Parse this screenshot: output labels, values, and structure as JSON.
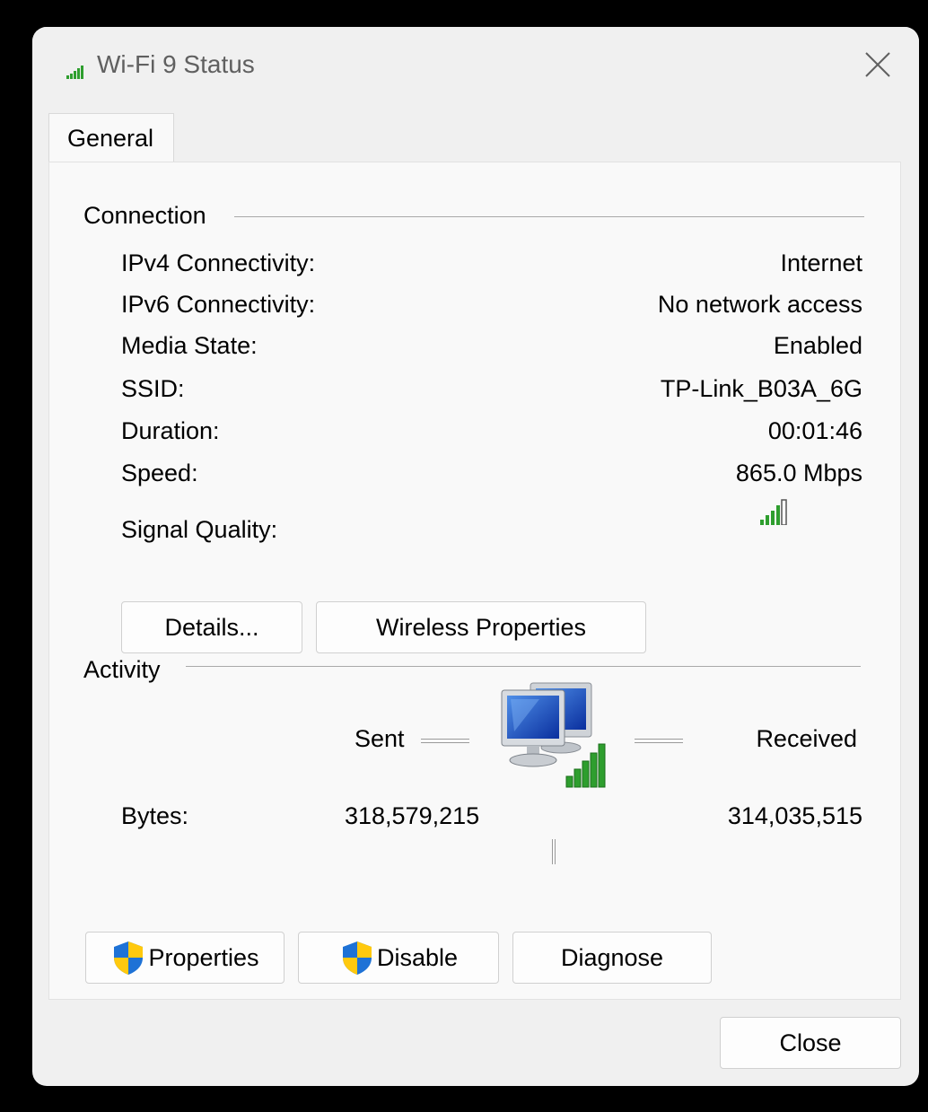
{
  "window": {
    "title": "Wi-Fi 9 Status"
  },
  "tabs": [
    {
      "label": "General",
      "selected": true
    }
  ],
  "connection": {
    "heading": "Connection",
    "rows": [
      {
        "label": "IPv4 Connectivity:",
        "value": "Internet"
      },
      {
        "label": "IPv6 Connectivity:",
        "value": "No network access"
      },
      {
        "label": "Media State:",
        "value": "Enabled"
      },
      {
        "label": "SSID:",
        "value": "TP-Link_B03A_6G"
      },
      {
        "label": "Duration:",
        "value": "00:01:46"
      },
      {
        "label": "Speed:",
        "value": "865.0 Mbps"
      }
    ],
    "signal_label": "Signal Quality:",
    "signal_bars": 4,
    "signal_bars_total": 5,
    "details_button": "Details...",
    "wireless_button": "Wireless Properties"
  },
  "activity": {
    "heading": "Activity",
    "sent_label": "Sent",
    "received_label": "Received",
    "bytes_label": "Bytes:",
    "bytes_sent": "318,579,215",
    "bytes_received": "314,035,515"
  },
  "buttons": {
    "properties": "Properties",
    "disable": "Disable",
    "diagnose": "Diagnose",
    "close": "Close"
  },
  "icons": {
    "title": "wifi-signal-icon",
    "close": "close-icon",
    "signal": "signal-quality-icon",
    "network": "network-computers-icon",
    "shield": "uac-shield-icon"
  },
  "colors": {
    "signal_green": "#2e9e2e",
    "window_bg": "#f0f0f0",
    "panel_bg": "#f9f9f9"
  }
}
